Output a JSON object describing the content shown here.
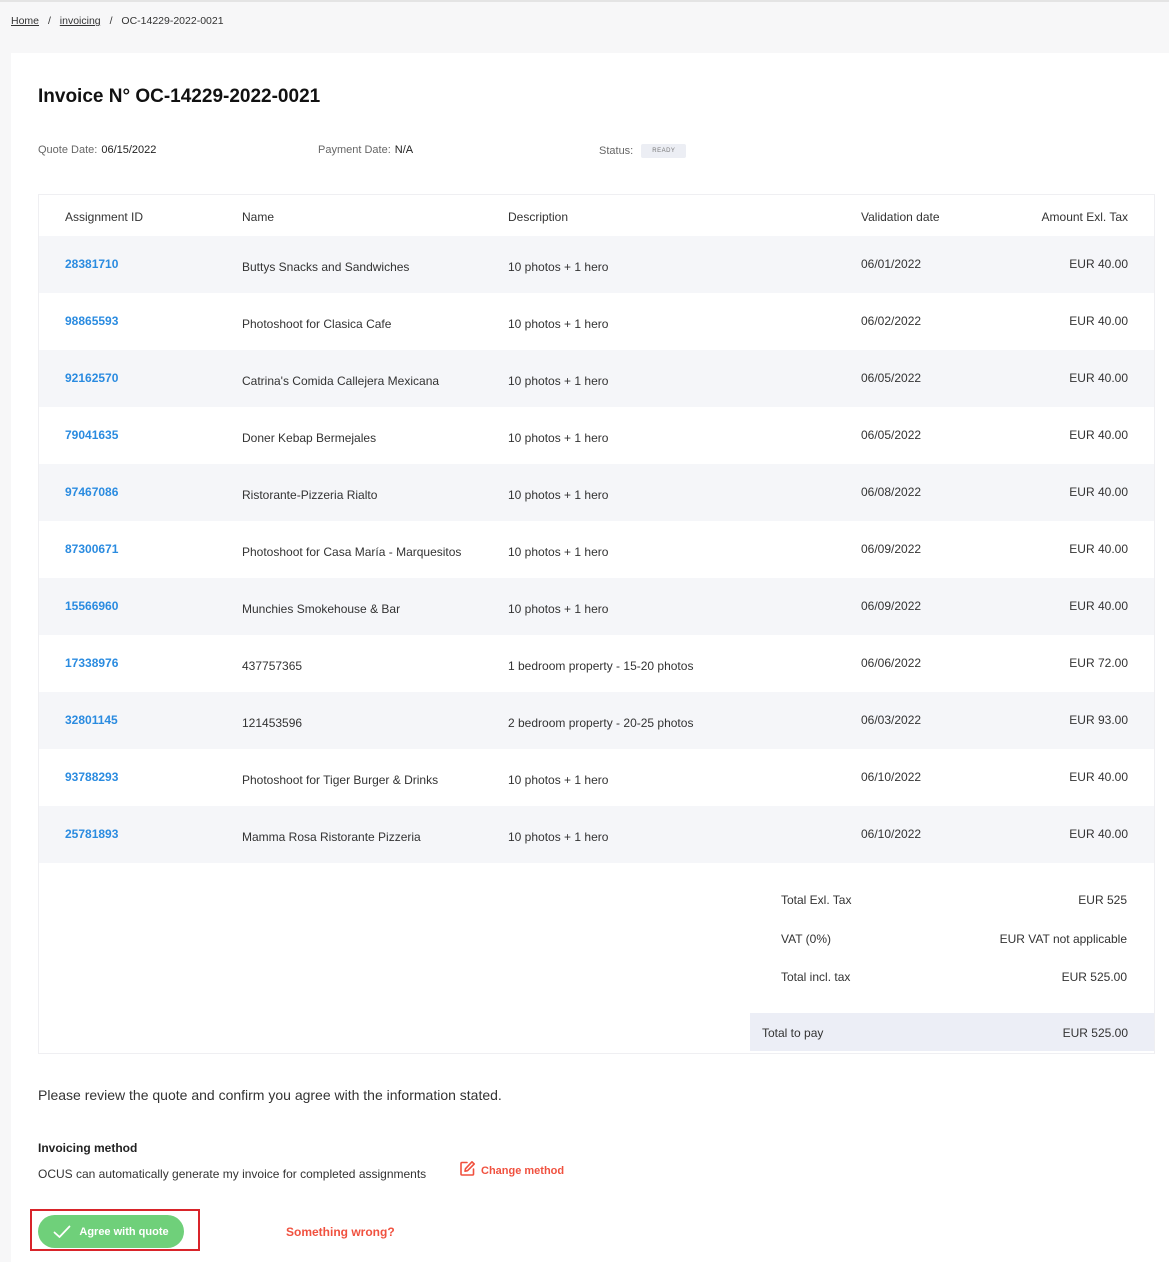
{
  "breadcrumb": {
    "home": "Home",
    "section": "invoicing",
    "separator": "/",
    "current": "OC-14229-2022-0021"
  },
  "invoice": {
    "title": "Invoice N° OC-14229-2022-0021",
    "quote_date_label": "Quote Date:",
    "quote_date": "06/15/2022",
    "payment_date_label": "Payment Date:",
    "payment_date": "N/A",
    "status_label": "Status:",
    "status": "READY"
  },
  "table": {
    "headers": [
      "Assignment ID",
      "Name",
      "Description",
      "Validation date",
      "Amount Exl. Tax"
    ],
    "rows": [
      {
        "id": "28381710",
        "name": "Buttys Snacks and Sandwiches",
        "desc": "10 photos + 1 hero",
        "date": "06/01/2022",
        "amount": "EUR 40.00"
      },
      {
        "id": "98865593",
        "name": "Photoshoot for Clasica Cafe",
        "desc": "10 photos + 1 hero",
        "date": "06/02/2022",
        "amount": "EUR 40.00"
      },
      {
        "id": "92162570",
        "name": "Catrina's Comida Callejera Mexicana",
        "desc": "10 photos + 1 hero",
        "date": "06/05/2022",
        "amount": "EUR 40.00"
      },
      {
        "id": "79041635",
        "name": "Doner Kebap Bermejales",
        "desc": "10 photos + 1 hero",
        "date": "06/05/2022",
        "amount": "EUR 40.00"
      },
      {
        "id": "97467086",
        "name": "Ristorante-Pizzeria Rialto",
        "desc": "10 photos + 1 hero",
        "date": "06/08/2022",
        "amount": "EUR 40.00"
      },
      {
        "id": "87300671",
        "name": "Photoshoot for Casa María - Marquesitos",
        "desc": "10 photos + 1 hero",
        "date": "06/09/2022",
        "amount": "EUR 40.00"
      },
      {
        "id": "15566960",
        "name": "Munchies Smokehouse & Bar",
        "desc": "10 photos + 1 hero",
        "date": "06/09/2022",
        "amount": "EUR 40.00"
      },
      {
        "id": "17338976",
        "name": "437757365",
        "desc": "1 bedroom property - 15-20 photos",
        "date": "06/06/2022",
        "amount": "EUR 72.00"
      },
      {
        "id": "32801145",
        "name": "121453596",
        "desc": "2 bedroom property - 20-25 photos",
        "date": "06/03/2022",
        "amount": "EUR 93.00"
      },
      {
        "id": "93788293",
        "name": "Photoshoot for Tiger Burger & Drinks",
        "desc": "10 photos + 1 hero",
        "date": "06/10/2022",
        "amount": "EUR 40.00"
      },
      {
        "id": "25781893",
        "name": "Mamma Rosa Ristorante Pizzeria",
        "desc": "10 photos + 1 hero",
        "date": "06/10/2022",
        "amount": "EUR 40.00"
      }
    ]
  },
  "totals": {
    "total_excl_label": "Total Exl. Tax",
    "total_excl": "EUR 525",
    "vat_label": "VAT (0%)",
    "vat": "EUR VAT not applicable",
    "total_incl_label": "Total incl. tax",
    "total_incl": "EUR 525.00",
    "to_pay_label": "Total to pay",
    "to_pay": "EUR 525.00"
  },
  "review_text": "Please review the quote and confirm you agree with the information stated.",
  "invoicing_method": {
    "title": "Invoicing method",
    "text": "OCUS can automatically generate my invoice for completed assignments",
    "change_label": "Change method"
  },
  "actions": {
    "agree_label": "Agree with quote",
    "wrong_label": "Something wrong?"
  },
  "colors": {
    "link": "#2a8be0",
    "accent_red": "#f0513f",
    "agree_green": "#6fd07a",
    "highlight_outline": "#d9242a"
  }
}
